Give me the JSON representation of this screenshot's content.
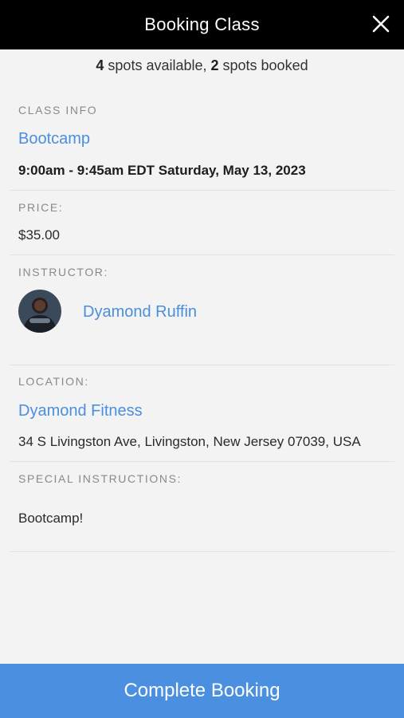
{
  "header": {
    "title": "Booking Class",
    "close_icon": "close-icon"
  },
  "availability": {
    "available_count": "4",
    "available_text": " spots available, ",
    "booked_count": "2",
    "booked_text": " spots booked"
  },
  "class_info": {
    "label": "CLASS INFO",
    "name": "Bootcamp",
    "schedule": "9:00am - 9:45am EDT Saturday, May 13, 2023"
  },
  "price": {
    "label": "PRICE:",
    "value": "$35.00"
  },
  "instructor": {
    "label": "INSTRUCTOR:",
    "name": "Dyamond Ruffin"
  },
  "location": {
    "label": "LOCATION:",
    "name": "Dyamond Fitness",
    "address": "34 S Livingston Ave, Livingston, New Jersey 07039, USA"
  },
  "special_instructions": {
    "label": "SPECIAL INSTRUCTIONS:",
    "text": "Bootcamp!"
  },
  "footer": {
    "button_label": "Complete Booking"
  },
  "colors": {
    "header_bg": "#000000",
    "link": "#4a8fdc",
    "button_bg": "#4a8fe0",
    "page_bg": "#f3f3f3"
  }
}
